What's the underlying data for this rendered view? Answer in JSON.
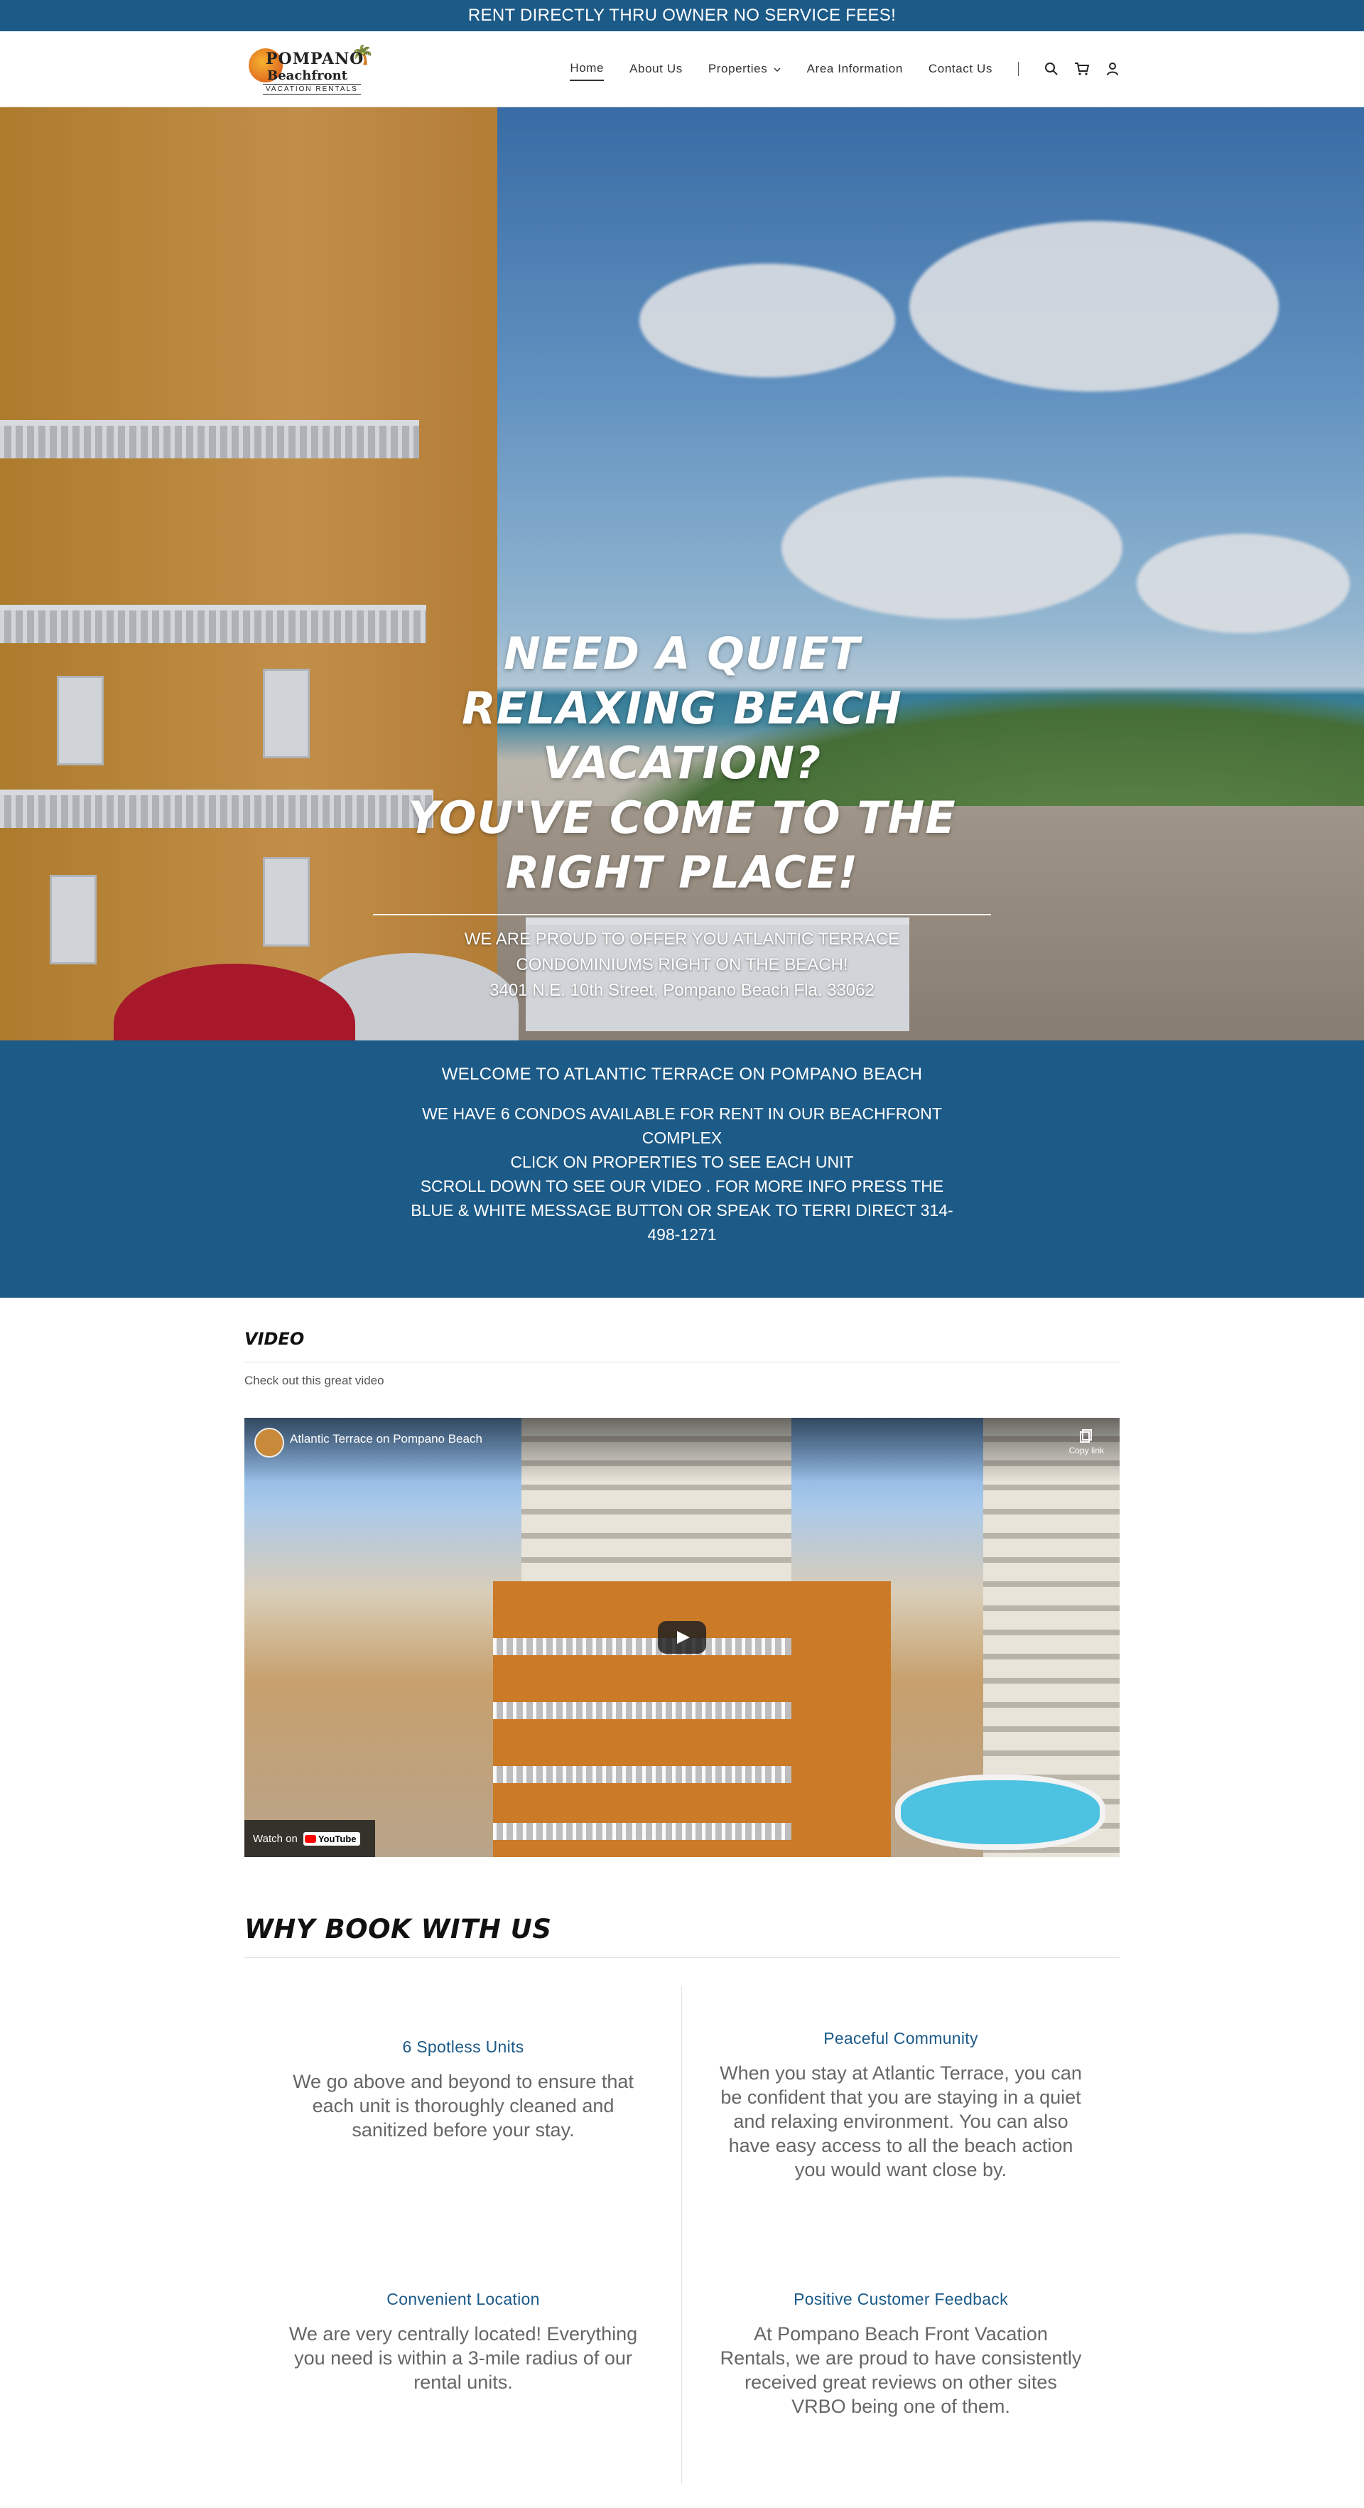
{
  "topbar": {
    "text": "RENT DIRECTLY THRU OWNER NO SERVICE FEES!"
  },
  "logo": {
    "line1": "POMPANO",
    "line2": "Beachfront",
    "line3": "VACATION RENTALS"
  },
  "nav": {
    "items": [
      "Home",
      "About Us",
      "Properties",
      "Area Information",
      "Contact Us"
    ],
    "active": "Home",
    "icons": [
      "search-icon",
      "cart-icon",
      "user-icon"
    ]
  },
  "hero": {
    "headline_1": "NEED A QUIET RELAXING BEACH VACATION?",
    "headline_2": "YOU'VE COME TO THE RIGHT PLACE!",
    "sub_1": "WE ARE PROUD TO OFFER YOU ATLANTIC TERRACE CONDOMINIUMS RIGHT ON THE BEACH!",
    "sub_2": "3401 N.E. 10th Street, Pompano Beach Fla. 33062"
  },
  "welcome": {
    "title": "WELCOME TO ATLANTIC TERRACE ON POMPANO BEACH",
    "line_1": "WE HAVE 6 CONDOS AVAILABLE FOR RENT IN OUR BEACHFRONT COMPLEX",
    "line_2": "CLICK ON PROPERTIES TO SEE EACH UNIT",
    "line_3": "SCROLL DOWN TO SEE OUR VIDEO .  FOR MORE INFO PRESS THE BLUE & WHITE MESSAGE BUTTON OR SPEAK TO TERRI DIRECT 314-498-1271"
  },
  "video": {
    "section_title": "VIDEO",
    "subtitle": "Check out this great video",
    "player_title": "Atlantic Terrace on Pompano Beach",
    "copy_label": "Copy link",
    "watch_on": "Watch on",
    "youtube": "YouTube"
  },
  "why": {
    "title": "WHY BOOK WITH US",
    "cards": [
      {
        "heading": "6 Spotless Units",
        "text": "We go above and beyond to ensure that each unit is thoroughly cleaned and sanitized before your stay."
      },
      {
        "heading": "Peaceful Community",
        "text": "When you stay at Atlantic Terrace, you can be confident that you are staying in a quiet and relaxing environment. You can also have easy access to all the beach action you would want close by."
      },
      {
        "heading": "Convenient Location",
        "text": "We are very centrally located! Everything you need is within a 3-mile radius of our rental units."
      },
      {
        "heading": "Positive Customer Feedback",
        "text": "At Pompano Beach Front Vacation Rentals, we are proud to have consistently received great reviews on other sites VRBO being one of them."
      }
    ]
  },
  "colors": {
    "brand_blue": "#1c5a88",
    "white": "#ffffff"
  }
}
